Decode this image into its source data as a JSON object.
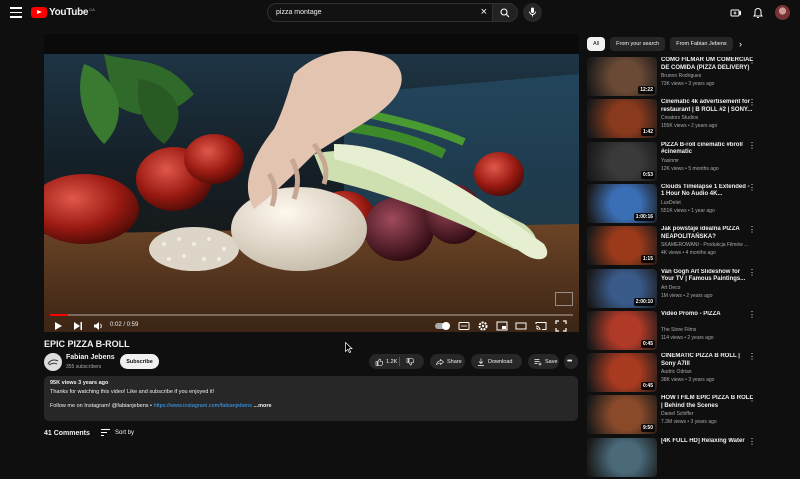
{
  "header": {
    "logo_text": "YouTube",
    "logo_country": "CA",
    "search_query": "pizza montage"
  },
  "player": {
    "time": "0:02 / 0:59",
    "progress": 0.034
  },
  "video": {
    "title": "EPIC PIZZA B-ROLL",
    "channel": "Fabian Jebens",
    "subscribers": "355 subscribers",
    "subscribe_label": "Subscribe",
    "likes": "1.2K",
    "share_label": "Share",
    "download_label": "Download",
    "save_label": "Save"
  },
  "description": {
    "meta": "95K views  3 years ago",
    "line1": "Thanks for watching this video! Like and subscribe if you enjoyed it!",
    "line2_prefix": "Follow me on Instagram! @fabianjebens  • ",
    "line2_link": "https://www.instagram.com/fabianjebens",
    "more": "...more"
  },
  "comments": {
    "count": "41 Comments",
    "sort_label": "Sort by"
  },
  "chips": [
    "All",
    "From your search",
    "From Fabian Jebens"
  ],
  "recommendations": [
    {
      "title": "COMO FILMAR UM COMERCIAL DE COMIDA (PIZZA DELIVERY)",
      "channel": "Brunno Rodrigues",
      "meta": "73K views • 3 years ago",
      "duration": "12:22",
      "color": "#6b4a35"
    },
    {
      "title": "Cinematic 4k advertisement for restaurant | B ROLL #2 | SONY...",
      "channel": "Creators Studios",
      "meta": "155K views • 2 years ago",
      "duration": "1:42",
      "color": "#8a3a1c"
    },
    {
      "title": "PIZZA B-roll cinematic #broll #cinematic",
      "channel": "Yasinmr",
      "meta": "12K views • 5 months ago",
      "duration": "0:53",
      "color": "#3a3a3a"
    },
    {
      "title": "Clouds Timelapse 1 Extended - 1 Hour No Audio 4K...",
      "channel": "LuxDelet",
      "meta": "551K views • 1 year ago",
      "duration": "1:00:16",
      "color": "#3b6fb5"
    },
    {
      "title": "Jak powstaje idealna PIZZA NEAPOLITAŃSKA?",
      "channel": "SKAMEROWANI - Produkcja Filmów ...",
      "meta": "4K views • 4 months ago",
      "duration": "1:15",
      "color": "#9a3a1a"
    },
    {
      "title": "Van Gogh Art Slideshow for Your TV | Famous Paintings...",
      "channel": "Art Deco",
      "meta": "1M views • 2 years ago",
      "duration": "2:00:10",
      "color": "#3a5a8a"
    },
    {
      "title": "Video Promo - PIZZA",
      "channel": "The Store Films",
      "meta": "114 views • 2 years ago",
      "duration": "0:45",
      "color": "#b03a28"
    },
    {
      "title": "CINEMATIC PIZZA B ROLL | Sony A7III",
      "channel": "Audric Odrian",
      "meta": "38K views • 3 years ago",
      "duration": "0:45",
      "color": "#a83a20"
    },
    {
      "title": "HOW I FILM EPIC PIZZA B ROLL | Behind the Scenes",
      "channel": "Daniel Schiffer",
      "meta": "7.3M views • 3 years ago",
      "duration": "9:50",
      "color": "#8a4a2a"
    },
    {
      "title": "[4K FULL HD] Relaxing Water",
      "channel": "",
      "meta": "",
      "duration": "",
      "color": "#4a6a7a"
    }
  ]
}
